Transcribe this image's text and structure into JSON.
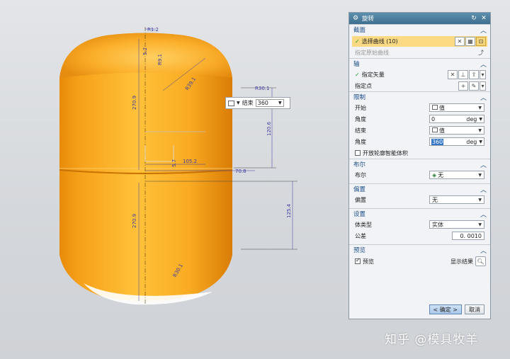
{
  "viewport": {
    "float_widget": {
      "end_label": "结束",
      "end_value": "360"
    },
    "dimensions": [
      "R1.2",
      "5.2",
      "R9.1",
      "R39.1",
      "270.9",
      "R30.1",
      "120.6",
      "5.7",
      "105.2",
      "70.8",
      "125.4",
      "270.9",
      "R30.1"
    ],
    "colors": {
      "tank": "#f6a61e",
      "dim": "#3a3aa0"
    }
  },
  "dialog": {
    "title": "旋转",
    "sections": {
      "section": {
        "header": "截面",
        "select_curve": "选择曲线 (10)",
        "origin_curve": "指定原始曲线"
      },
      "axis": {
        "header": "轴",
        "vector": "指定矢量",
        "point": "指定点"
      },
      "limits": {
        "header": "限制",
        "start_label": "开始",
        "start_option": "值",
        "angle_label": "角度",
        "start_angle": "0",
        "unit": "deg",
        "end_label": "结束",
        "end_option": "值",
        "angle2_label": "角度",
        "end_angle": "360",
        "open_profile": "开放轮廓智能体积"
      },
      "boolean": {
        "header": "布尔",
        "label": "布尔",
        "value": "无"
      },
      "offset": {
        "header": "偏置",
        "label": "偏置",
        "value": "无"
      },
      "settings": {
        "header": "设置",
        "body_type_label": "体类型",
        "body_type_value": "实体",
        "tolerance_label": "公差",
        "tolerance_value": "0. 0010"
      },
      "preview": {
        "header": "预览",
        "preview_label": "预览",
        "show_result": "显示结果"
      }
    },
    "buttons": {
      "ok": "< 确定 >",
      "cancel": "取消"
    },
    "colors": {
      "title_bar": "#4a7d9d",
      "section_header": "#1b4c8a",
      "selection": "#fcd983"
    }
  },
  "watermark": "知乎 @模具牧羊"
}
